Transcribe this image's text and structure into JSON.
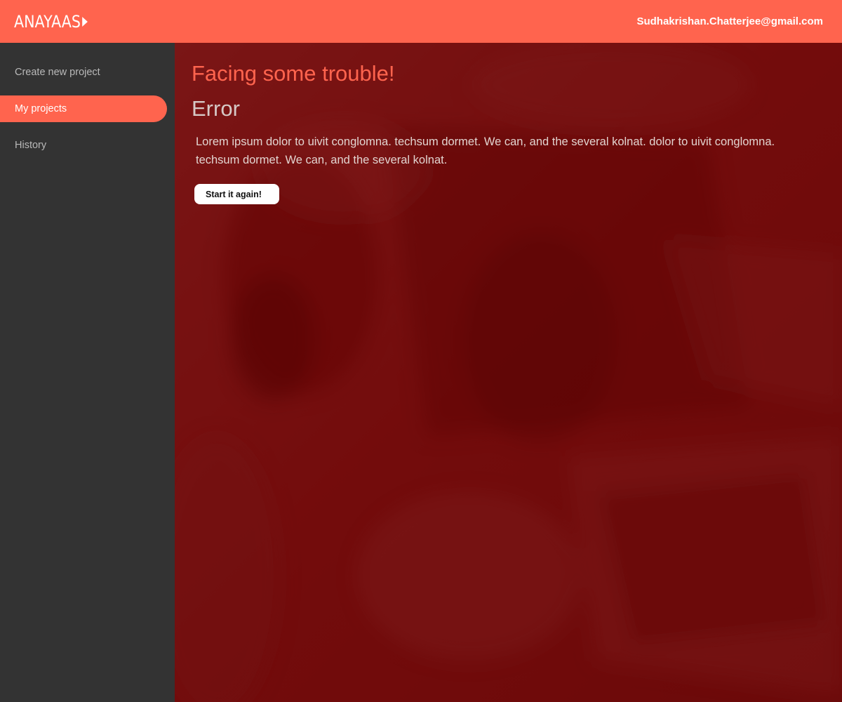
{
  "header": {
    "logo_text": "ANAYAAS",
    "logo_icon": "play-triangle-icon",
    "user_email": "Sudhakrishan.Chatterjee@gmail.com"
  },
  "sidebar": {
    "items": [
      {
        "label": "Create new project",
        "active": false
      },
      {
        "label": "My projects",
        "active": true
      },
      {
        "label": "History",
        "active": false
      }
    ]
  },
  "main": {
    "heading": "Facing some trouble!",
    "error_title": "Error",
    "error_description": "Lorem ipsum dolor to uivit conglomna. techsum dormet. We can, and the several kolnat. dolor to uivit conglomna. techsum dormet. We can, and the several kolnat.",
    "action_button": "Start it again!"
  },
  "colors": {
    "accent": "#ff644e",
    "sidebar_bg": "#333333",
    "overlay": "#6e0505"
  }
}
